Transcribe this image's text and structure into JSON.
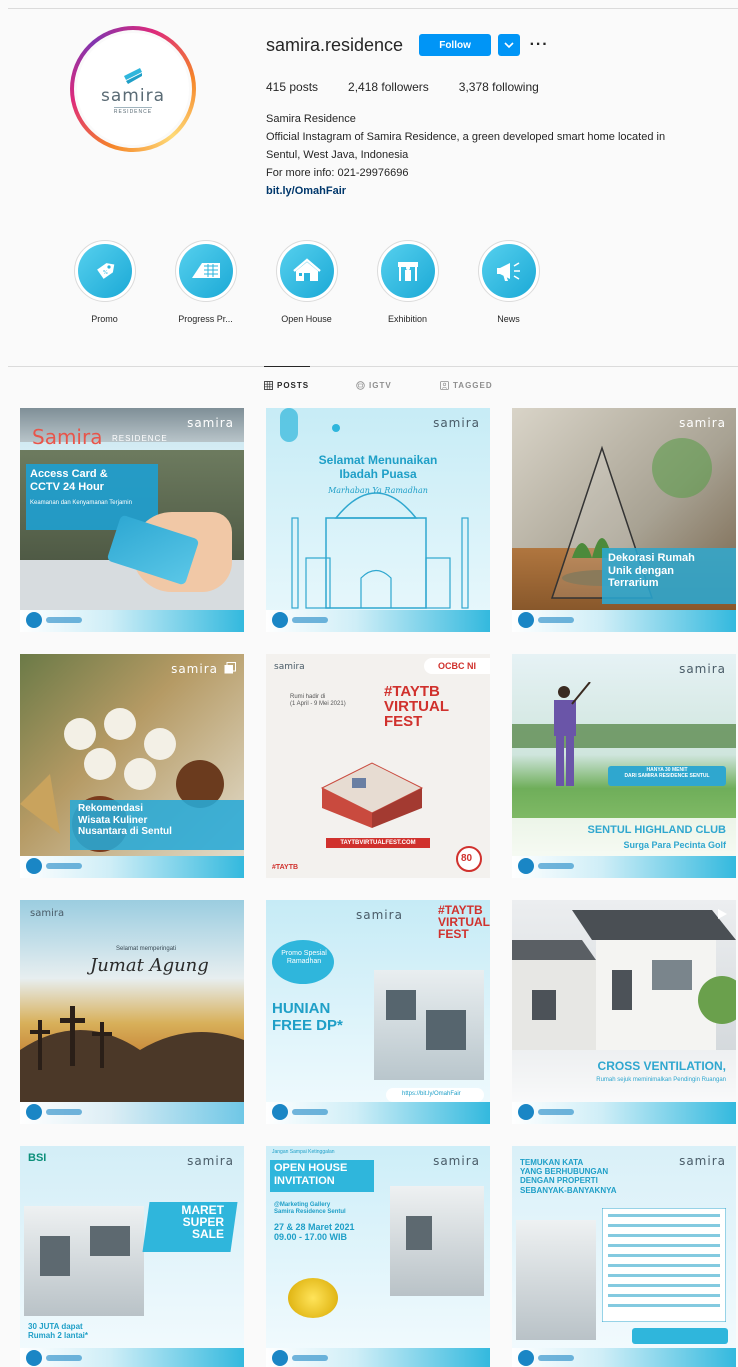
{
  "profile": {
    "username": "samira.residence",
    "follow_label": "Follow",
    "more_label": "···",
    "avatar": {
      "logo_word": "samira",
      "logo_sub": "RESIDENCE"
    },
    "stats": {
      "posts": "415",
      "posts_label": " posts",
      "followers": "2,418",
      "followers_label": " followers",
      "following": "3,378",
      "following_label": " following"
    },
    "bio": {
      "full_name": "Samira Residence",
      "line1": "Official Instagram of Samira Residence, a green developed smart home located in",
      "line2": "Sentul, West Java, Indonesia",
      "line3": "For more info: 021-29976696",
      "link": "bit.ly/OmahFair"
    }
  },
  "highlights": [
    {
      "label": "Promo",
      "icon": "price-tag-icon"
    },
    {
      "label": "Progress Pr...",
      "icon": "construction-roof-icon"
    },
    {
      "label": "Open House",
      "icon": "house-icon"
    },
    {
      "label": "Exhibition",
      "icon": "booth-icon"
    },
    {
      "label": "News",
      "icon": "megaphone-icon"
    }
  ],
  "tabs": [
    {
      "label": "POSTS",
      "icon": "grid-icon",
      "active": true
    },
    {
      "label": "IGTV",
      "icon": "igtv-icon",
      "active": false
    },
    {
      "label": "TAGGED",
      "icon": "tagged-icon",
      "active": false
    }
  ],
  "posts": {
    "p1": {
      "banner": "Samira",
      "banner_small": "RESIDENCE",
      "brand": "samira",
      "title": "Access Card &\nCCTV 24 Hour",
      "subtitle": "Keamanan dan Kenyamanan Terjamin"
    },
    "p2": {
      "brand": "samira",
      "title": "Selamat Menunaikan\nIbadah Puasa",
      "subtitle": "Marhaban Ya Ramadhan"
    },
    "p3": {
      "brand": "samira",
      "title": "Dekorasi Rumah\nUnik dengan\nTerrarium"
    },
    "p4": {
      "brand": "samira",
      "title": "Rekomendasi\nWisata Kuliner\nNusantara di Sentul"
    },
    "p5": {
      "brand": "samira",
      "bank": "OCBC NI",
      "title": "#TAYTB\nVIRTUAL\nFEST",
      "dates": "Rumi hadir di\n(1 April - 9 Mei 2021)",
      "url": "TAYTBVIRTUALFEST.COM",
      "footer": "#TAYTB",
      "badge": "80"
    },
    "p6": {
      "brand": "samira",
      "small": "HANYA 30 MENIT\nDARI SAMIRA RESIDENCE SENTUL",
      "title": "SENTUL HIGHLAND CLUB",
      "subtitle": "Surga Para Pecinta Golf"
    },
    "p7": {
      "brand": "samira",
      "small": "Selamat memperingati",
      "title": "Jumat Agung"
    },
    "p8": {
      "brand": "samira",
      "tag": "#TAYTB\nVIRTUAL\nFEST",
      "promo": "Promo Spesial\nRamadhan",
      "title": "HUNIAN\nFREE DP*",
      "link": "https://bit.ly/OmahFair"
    },
    "p9": {
      "title": "CROSS VENTILATION,",
      "subtitle": "Rumah sejuk meminimalkan Pendingin Ruangan"
    },
    "p10": {
      "bank": "BSI",
      "brand": "samira",
      "title": "MARET\nSUPER\nSALE",
      "subtitle": "30 JUTA dapat\nRumah 2 lantai*"
    },
    "p11": {
      "brand": "samira",
      "small": "Jangan Sampai Ketinggalan",
      "title": "OPEN HOUSE\nINVITATION",
      "venue": "@Marketing Gallery\nSamira Residence Sentul",
      "when": "27 & 28 Maret 2021\n09.00 - 17.00 WIB"
    },
    "p12": {
      "brand": "samira",
      "title": "TEMUKAN KATA\nYANG BERHUBUNGAN\nDENGAN PROPERTI\nSEBANYAK-BANYAKNYA"
    }
  },
  "colors": {
    "accent": "#0095f6",
    "highlight": "#1ba9d6",
    "brand_teal": "#2fb6dc"
  }
}
